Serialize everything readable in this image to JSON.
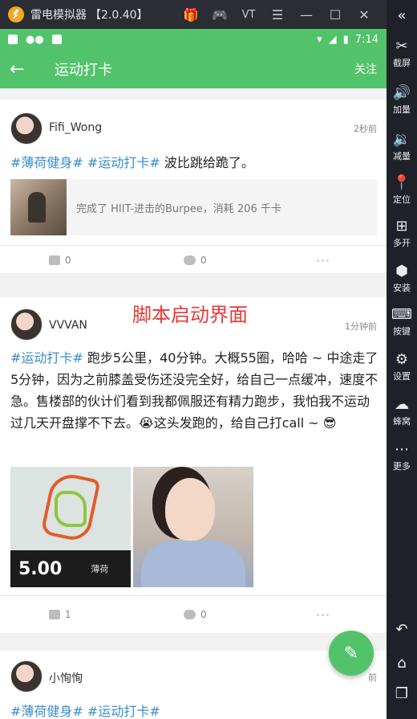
{
  "emulator": {
    "title": "雷电模拟器",
    "version": "【2.0.40】",
    "controls": [
      "gift-icon",
      "gamepad-icon",
      "VT",
      "menu-icon",
      "minimize-icon",
      "maximize-icon",
      "close-icon"
    ],
    "vt_label": "VT",
    "sidebar": [
      {
        "label": "截屏",
        "icon": "scissors-icon"
      },
      {
        "label": "加量",
        "icon": "volume-up-icon"
      },
      {
        "label": "减量",
        "icon": "volume-down-icon"
      },
      {
        "label": "定位",
        "icon": "location-icon"
      },
      {
        "label": "多开",
        "icon": "multi-open-icon"
      },
      {
        "label": "安装",
        "icon": "apk-icon"
      },
      {
        "label": "按键",
        "icon": "keyboard-icon"
      },
      {
        "label": "设置",
        "icon": "gear-icon"
      },
      {
        "label": "蜂窝",
        "icon": "bee-icon"
      },
      {
        "label": "更多",
        "icon": "more-icon"
      }
    ]
  },
  "status_bar": {
    "time": "7:14"
  },
  "app_bar": {
    "title": "运动打卡",
    "action": "关注"
  },
  "overlay_text": "脚本启动界面",
  "posts": [
    {
      "author": "Fifi_Wong",
      "time": "2秒前",
      "tags": [
        "#薄荷健身#",
        "#运动打卡#"
      ],
      "text": " 波比跳给跪了。",
      "activity": "完成了 HIIT-进击的Burpee，消耗 206 千卡",
      "likes": "0",
      "comments": "0",
      "more": "···"
    },
    {
      "author": "VVVAN",
      "time": "1分钟前",
      "tags": [
        "#运动打卡#"
      ],
      "text": " 跑步5公里，40分钟。大概55圈，哈哈 ~ 中途走了5分钟，因为之前膝盖受伤还没完全好，给自己一点缓冲，速度不急。售楼部的伙计们看到我都佩服还有精力跑步，我怕我不运动过几天开盘撑不下去。😭这头发跑的，给自己打call ~ 😎",
      "map_distance": "5.00",
      "map_label": "薄荷",
      "likes": "1",
      "comments": "0",
      "more": "···"
    },
    {
      "author": "小恂恂",
      "time": "前",
      "tags": [
        "#薄荷健身#",
        "#运动打卡#"
      ]
    }
  ],
  "colors": {
    "brand": "#52c36a",
    "tag": "#3a8ec9",
    "overlay": "#e53935"
  }
}
